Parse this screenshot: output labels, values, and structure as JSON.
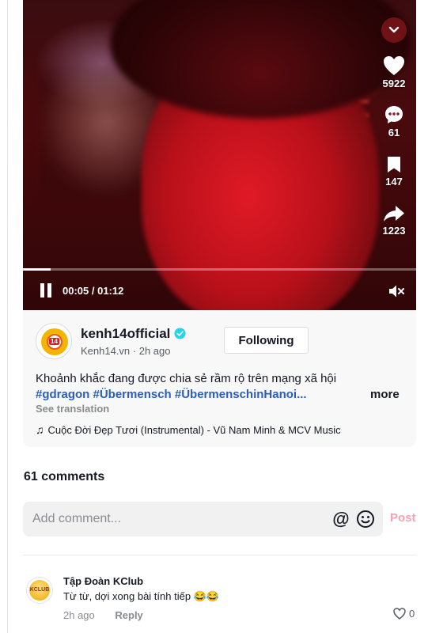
{
  "video": {
    "time_display": "00:05 / 01:12",
    "progress": 0.07,
    "actions": {
      "likes": "5922",
      "comments": "61",
      "saves": "147",
      "shares": "1223"
    }
  },
  "author": {
    "username": "kenh14official",
    "display_name": "Kenh14.vn",
    "separator": " · ",
    "posted": "2h ago",
    "avatar_text": "14"
  },
  "follow_label": "Following",
  "description": {
    "text": "Khoảnh khắc đang được chia sẻ rầm rộ trên mạng xã hội",
    "hashtags": "#gdragon #Übermensch #ÜbermenschinHanoi...",
    "more_label": "more",
    "see_translation": "See translation"
  },
  "music": {
    "title": "Cuộc Đời Đẹp Tươi (Instrumental) - Vũ Nam Minh & MCV Music"
  },
  "comments": {
    "count_label": "61 comments",
    "input_placeholder": "Add comment...",
    "post_label": "Post",
    "items": [
      {
        "author": "Tập Đoàn KClub",
        "avatar_text": "KCLUB",
        "text": "Từ từ, dợi xong bài tính tiếp 😂😂",
        "time": "2h ago",
        "reply_label": "Reply",
        "likes": "0"
      }
    ]
  },
  "colors": {
    "accent_pink": "#f7a2b3",
    "hashtag_blue": "#2b5db9",
    "verified": "#20d5ec"
  }
}
